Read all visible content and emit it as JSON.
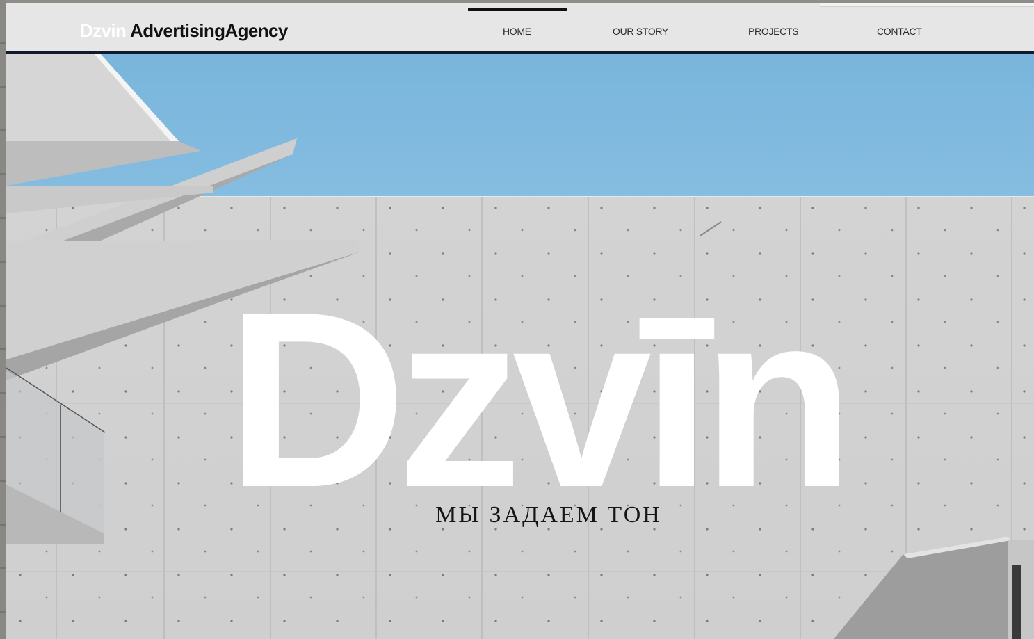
{
  "header": {
    "brand": {
      "part1": "Dzvin ",
      "part2": "AdvertisingAgency"
    },
    "nav": [
      {
        "label": "HOME",
        "active": true
      },
      {
        "label": "OUR STORY",
        "active": false
      },
      {
        "label": "PROJECTS",
        "active": false
      },
      {
        "label": "CONTACT",
        "active": false
      }
    ]
  },
  "hero": {
    "title": "Dzvīn",
    "tagline": "МЫ ЗАДАЕМ ТОН"
  },
  "colors": {
    "header_bg": "#e6e6e6",
    "header_border": "#121a2e",
    "sky": "#7fb8de",
    "concrete": "#d2d2d2",
    "hero_text": "#ffffff",
    "tagline_text": "#151515"
  }
}
